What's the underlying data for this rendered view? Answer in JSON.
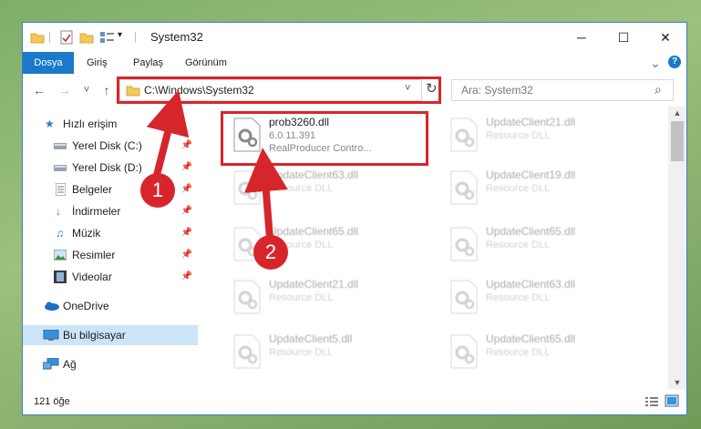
{
  "window": {
    "title": "System32",
    "minimize_icon": "─",
    "maximize_icon": "☐",
    "close_icon": "✕"
  },
  "ribbon": {
    "tabs": [
      "Dosya",
      "Giriş",
      "Paylaş",
      "Görünüm"
    ],
    "expand_icon": "⌄",
    "help_icon": "?"
  },
  "address": {
    "back_icon": "←",
    "forward_icon": "→",
    "recent_icon": "˅",
    "up_icon": "↑",
    "path": "C:\\Windows\\System32",
    "dropdown_icon": "˅",
    "refresh_icon": "↻"
  },
  "search": {
    "placeholder": "Ara: System32",
    "icon": "⌕"
  },
  "nav": {
    "quick_access": "Hızlı erişim",
    "items": [
      {
        "label": "Yerel Disk (C:)",
        "icon": "drive-icon",
        "pinned": true
      },
      {
        "label": "Yerel Disk (D:)",
        "icon": "drive-icon",
        "pinned": true
      },
      {
        "label": "Belgeler",
        "icon": "documents-icon",
        "pinned": true
      },
      {
        "label": "İndirmeler",
        "icon": "downloads-icon",
        "pinned": true
      },
      {
        "label": "Müzik",
        "icon": "music-icon",
        "pinned": true
      },
      {
        "label": "Resimler",
        "icon": "pictures-icon",
        "pinned": true
      },
      {
        "label": "Videolar",
        "icon": "videos-icon",
        "pinned": true
      }
    ],
    "onedrive": "OneDrive",
    "this_pc": "Bu bilgisayar",
    "network": "Ağ",
    "pin_icon": "📌"
  },
  "files": [
    {
      "name": "prob3260.dll",
      "line1": "6.0.11.391",
      "line2": "RealProducer Contro...",
      "highlighted": true
    },
    {
      "name": "UpdateClient21.dll",
      "line1": "Resource DLL"
    },
    {
      "name": "UpdateClient63.dll",
      "line1": "Resource DLL"
    },
    {
      "name": "UpdateClient19.dll",
      "line1": "Resource DLL"
    },
    {
      "name": "UpdateClient65.dll",
      "line1": "Resource DLL"
    },
    {
      "name": "UpdateClient65.dll",
      "line1": "Resource DLL"
    },
    {
      "name": "UpdateClient21.dll",
      "line1": "Resource DLL"
    },
    {
      "name": "UpdateClient63.dll",
      "line1": "Resource DLL"
    },
    {
      "name": "UpdateClient5.dll",
      "line1": "Resource DLL"
    },
    {
      "name": "UpdateClient65.dll",
      "line1": "Resource DLL"
    }
  ],
  "status": {
    "count": "121 öğe"
  },
  "annotations": {
    "step1": "1",
    "step2": "2",
    "color": "#d7262b"
  }
}
